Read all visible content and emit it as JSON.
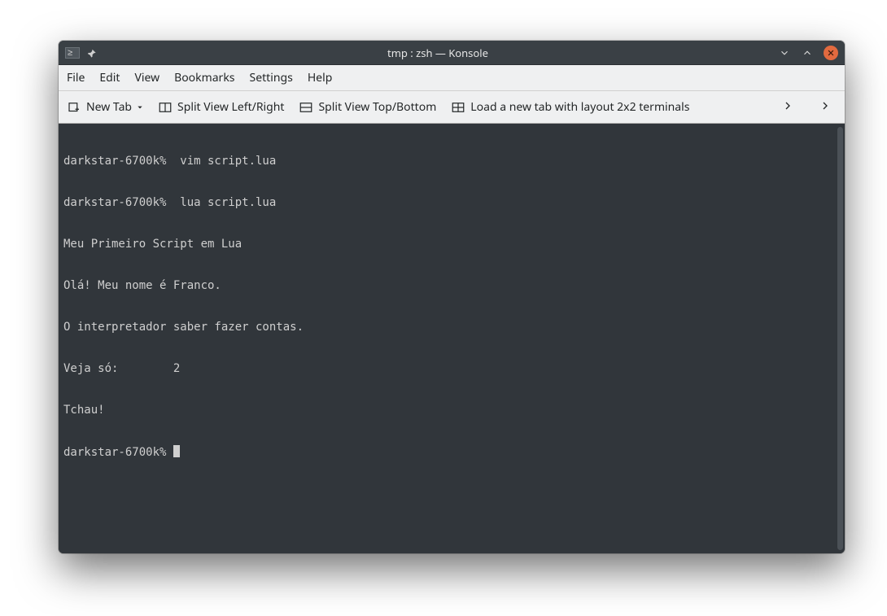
{
  "window": {
    "title": "tmp : zsh — Konsole"
  },
  "menu": {
    "file": "File",
    "edit": "Edit",
    "view": "View",
    "bookmarks": "Bookmarks",
    "settings": "Settings",
    "help": "Help"
  },
  "toolbar": {
    "new_tab": "New Tab",
    "split_lr": "Split View Left/Right",
    "split_tb": "Split View Top/Bottom",
    "load_layout": "Load a new tab with layout 2x2 terminals"
  },
  "terminal": {
    "lines": [
      "darkstar-6700k%  vim script.lua",
      "darkstar-6700k%  lua script.lua",
      "Meu Primeiro Script em Lua",
      "Olá! Meu nome é Franco.",
      "O interpretador saber fazer contas.",
      "Veja só:        2",
      "Tchau!"
    ],
    "prompt": "darkstar-6700k% "
  }
}
